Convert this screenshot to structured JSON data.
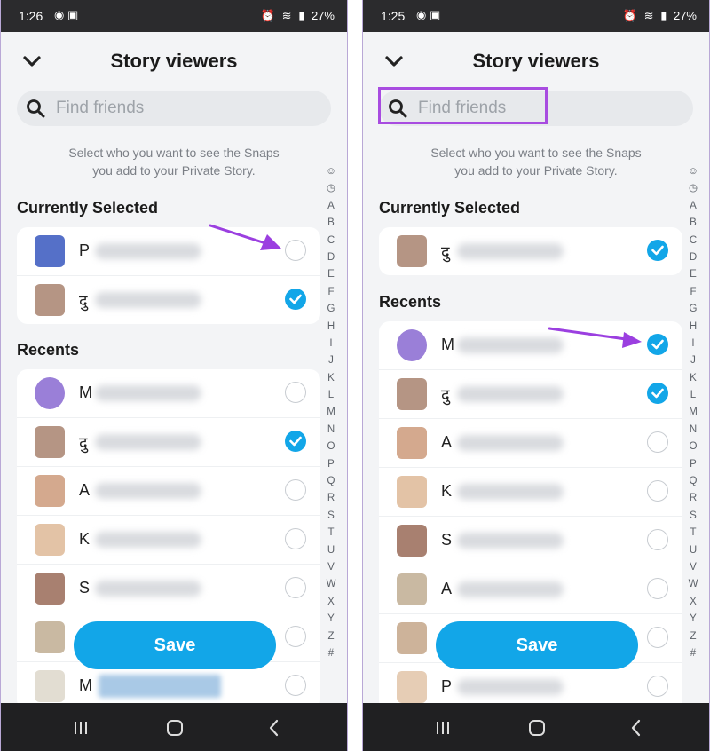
{
  "left": {
    "status": {
      "time": "1:26",
      "battery": "27%"
    },
    "header": {
      "title": "Story viewers"
    },
    "search": {
      "placeholder": "Find friends"
    },
    "helper": {
      "line1": "Select who you want to see the Snaps",
      "line2": "you add to your Private Story."
    },
    "current_heading": "Currently Selected",
    "current": [
      {
        "initial": "P",
        "checked": false
      },
      {
        "initial": "दु",
        "checked": true
      }
    ],
    "recents_heading": "Recents",
    "recents": [
      {
        "initial": "M",
        "checked": false
      },
      {
        "initial": "दु",
        "checked": true
      },
      {
        "initial": "A",
        "checked": false
      },
      {
        "initial": "K",
        "checked": false
      },
      {
        "initial": "S",
        "checked": false
      },
      {
        "initial": "A",
        "checked": false
      },
      {
        "initial": "M",
        "checked": false
      }
    ],
    "save_label": "Save"
  },
  "right": {
    "status": {
      "time": "1:25",
      "battery": "27%"
    },
    "header": {
      "title": "Story viewers"
    },
    "search": {
      "placeholder": "Find friends"
    },
    "helper": {
      "line1": "Select who you want to see the Snaps",
      "line2": "you add to your Private Story."
    },
    "current_heading": "Currently Selected",
    "current": [
      {
        "initial": "दु",
        "checked": true
      }
    ],
    "recents_heading": "Recents",
    "recents": [
      {
        "initial": "M",
        "checked": true
      },
      {
        "initial": "दु",
        "checked": true
      },
      {
        "initial": "A",
        "checked": false
      },
      {
        "initial": "K",
        "checked": false
      },
      {
        "initial": "S",
        "checked": false
      },
      {
        "initial": "A",
        "checked": false
      },
      {
        "initial": "",
        "checked": false
      },
      {
        "initial": "P",
        "checked": false
      }
    ],
    "save_label": "Save"
  },
  "alphabet": [
    "A",
    "B",
    "C",
    "D",
    "E",
    "F",
    "G",
    "H",
    "I",
    "J",
    "K",
    "L",
    "M",
    "N",
    "O",
    "P",
    "Q",
    "R",
    "S",
    "T",
    "U",
    "V",
    "W",
    "X",
    "Y",
    "Z",
    "#"
  ],
  "colors": {
    "accent": "#12a6e8",
    "highlight": "#a84ce0",
    "arrow": "#9b3fe0"
  },
  "icons": [
    "chevron-down-icon",
    "search-icon",
    "checkmark-icon",
    "smiley-icon",
    "clock-icon",
    "recents-nav-icon",
    "home-nav-icon",
    "back-nav-icon"
  ]
}
